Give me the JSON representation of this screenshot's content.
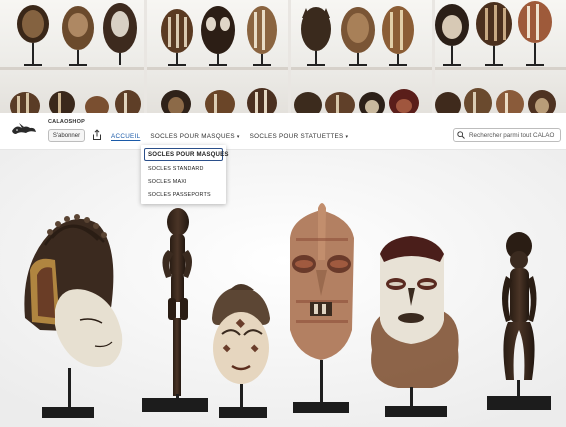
{
  "shop": {
    "name": "CALAOSHOP",
    "subscribe_label": "S'abonner"
  },
  "nav": {
    "items": [
      {
        "label": "ACCUEIL",
        "active": true,
        "has_menu": false
      },
      {
        "label": "SOCLES POUR MASQUES",
        "active": false,
        "has_menu": true
      },
      {
        "label": "SOCLES POUR STATUETTES",
        "active": false,
        "has_menu": true
      }
    ]
  },
  "search": {
    "placeholder": "Rechercher parmi tout CALAO"
  },
  "dropdown": {
    "items": [
      {
        "label": "SOCLES POUR MASQUES",
        "selected": true
      },
      {
        "label": "SOCLES STANDARD",
        "selected": false
      },
      {
        "label": "SOCLES MAXI",
        "selected": false
      },
      {
        "label": "SOCLES PASSEPORTS",
        "selected": false
      }
    ]
  },
  "colors": {
    "accent": "#1a5aa8",
    "dropdown_border": "#2b4f8a",
    "stand": "#1e1e1e"
  },
  "icons": {
    "logo": "calao-logo",
    "share": "share-icon",
    "search": "search-icon",
    "chevron": "chevron-down-icon"
  }
}
